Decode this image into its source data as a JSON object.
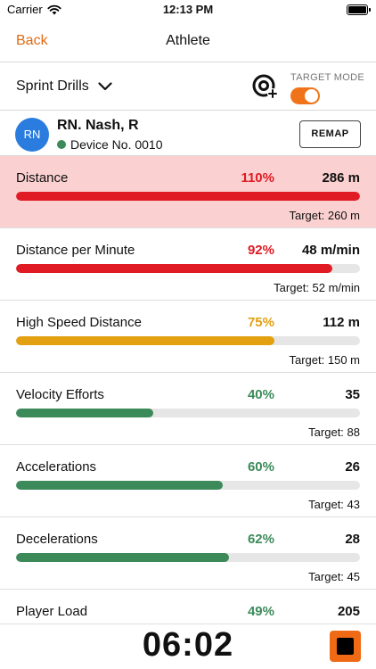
{
  "status": {
    "carrier": "Carrier",
    "time": "12:13 PM"
  },
  "nav": {
    "back_label": "Back",
    "title": "Athlete"
  },
  "drill": {
    "selected": "Sprint Drills",
    "target_mode_label": "TARGET MODE",
    "target_mode_on": true
  },
  "athlete": {
    "initials": "RN",
    "name": "RN. Nash, R",
    "device": "Device No. 0010",
    "remap_label": "REMAP"
  },
  "colors": {
    "accent": "#f17319",
    "over_red": "#e01b24",
    "warning_amber": "#e3a011",
    "ok_green": "#3c8a5a",
    "over_bg": "#fbd0d0"
  },
  "metrics": [
    {
      "label": "Distance",
      "percent": "110%",
      "value": "286 m",
      "target": "Target: 260 m",
      "fill": 1.0,
      "status": "over"
    },
    {
      "label": "Distance per Minute",
      "percent": "92%",
      "value": "48 m/min",
      "target": "Target: 52 m/min",
      "fill": 0.92,
      "status": "red"
    },
    {
      "label": "High Speed Distance",
      "percent": "75%",
      "value": "112 m",
      "target": "Target: 150 m",
      "fill": 0.75,
      "status": "amber"
    },
    {
      "label": "Velocity Efforts",
      "percent": "40%",
      "value": "35",
      "target": "Target: 88",
      "fill": 0.4,
      "status": "green"
    },
    {
      "label": "Accelerations",
      "percent": "60%",
      "value": "26",
      "target": "Target: 43",
      "fill": 0.6,
      "status": "green"
    },
    {
      "label": "Decelerations",
      "percent": "62%",
      "value": "28",
      "target": "Target: 45",
      "fill": 0.62,
      "status": "green"
    },
    {
      "label": "Player Load",
      "percent": "49%",
      "value": "205",
      "target": "",
      "fill": 0.49,
      "status": "green"
    }
  ],
  "timer": {
    "elapsed": "06:02",
    "stop_icon": "stop-icon"
  }
}
